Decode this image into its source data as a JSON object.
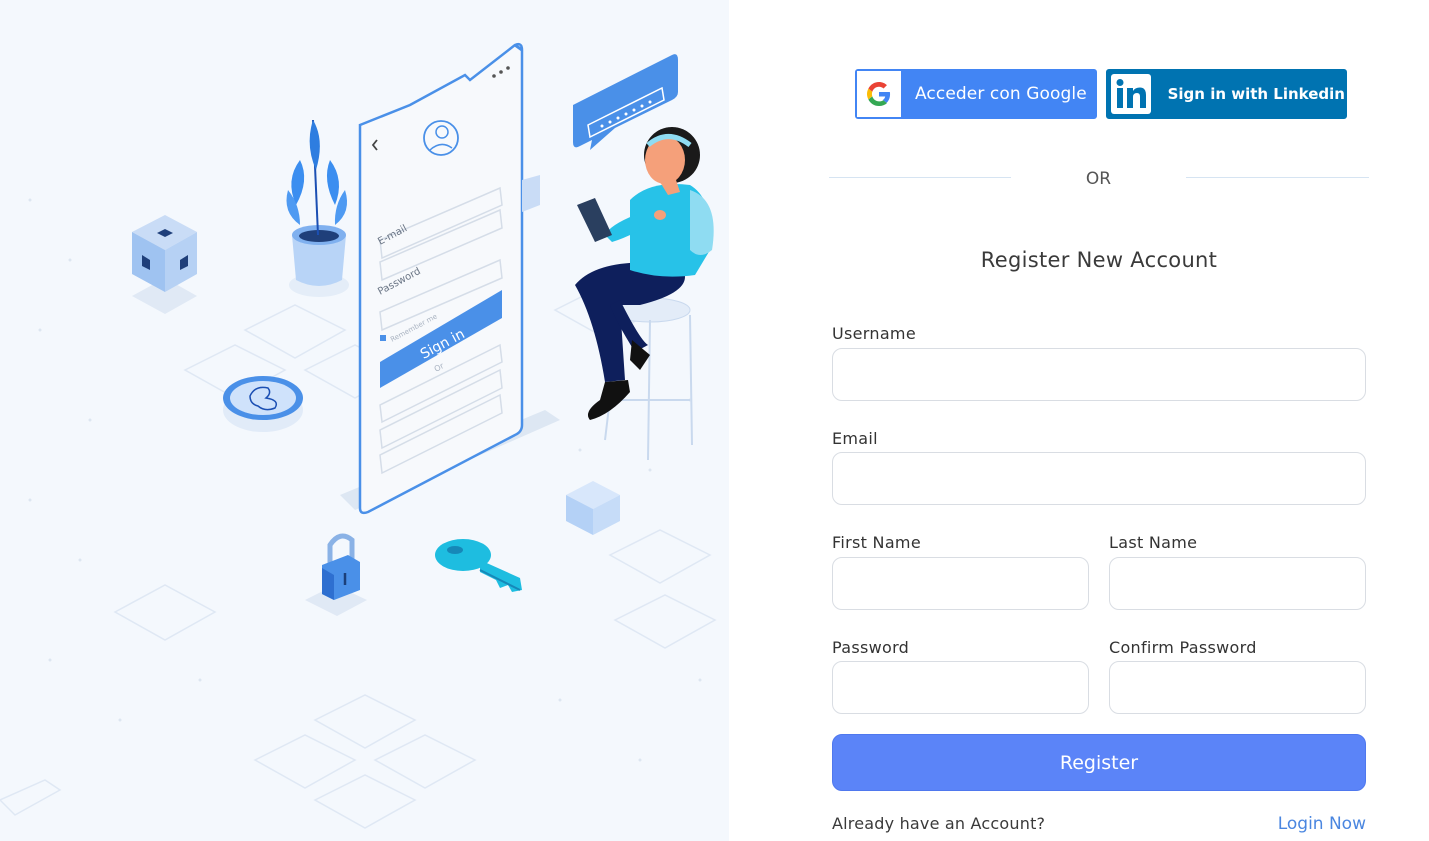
{
  "social": {
    "google_label": "Acceder con Google",
    "linkedin_label": "Sign in with Linkedin"
  },
  "divider": {
    "text": "OR"
  },
  "form": {
    "title": "Register New Account",
    "username_label": "Username",
    "email_label": "Email",
    "first_name_label": "First Name",
    "last_name_label": "Last Name",
    "password_label": "Password",
    "confirm_password_label": "Confirm Password",
    "username_value": "",
    "email_value": "",
    "first_name_value": "",
    "last_name_value": "",
    "password_value": "",
    "confirm_password_value": "",
    "register_label": "Register"
  },
  "footer": {
    "prompt": "Already have an Account?",
    "login_label": "Login Now"
  },
  "illustration": {
    "phone_field_email": "E-mail",
    "phone_field_password": "Password",
    "phone_remember": "Remember me",
    "phone_button": "Sign in",
    "phone_or": "Or"
  },
  "colors": {
    "accent": "#5b84f8",
    "google_blue": "#4285f4",
    "linkedin_blue": "#0073b1",
    "link": "#4a86e0"
  }
}
